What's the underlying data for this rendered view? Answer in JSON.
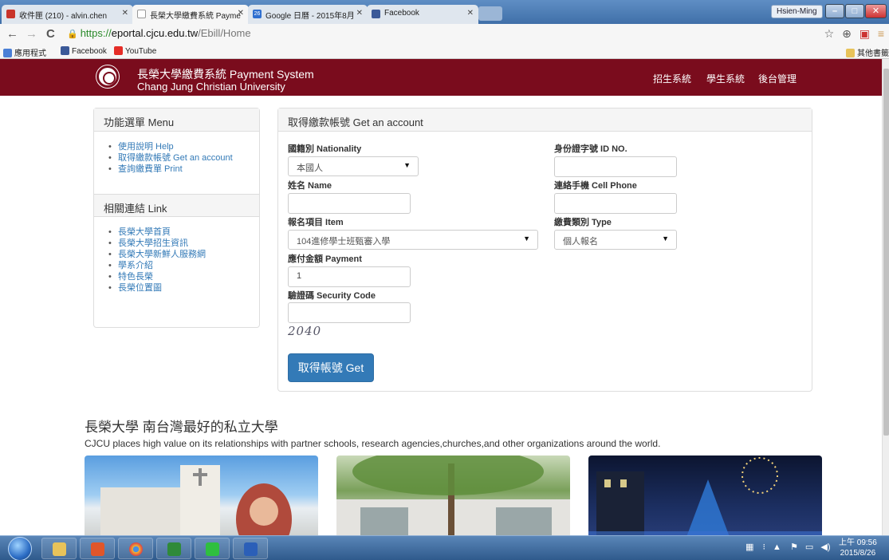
{
  "browser": {
    "tabs": [
      {
        "title": "收件匣 (210) - alvin.chen",
        "icon_color": "#c9342b"
      },
      {
        "title": "長榮大學繳費系統 Payme",
        "icon_color": "#ffffff"
      },
      {
        "title": "Google 日曆 - 2015年8月",
        "icon_color": "#2f6fd0",
        "icon_text": "26"
      },
      {
        "title": "Facebook",
        "icon_color": "#3b5998"
      }
    ],
    "user": "Hsien-Ming",
    "url": {
      "scheme": "https://",
      "host": "eportal.cjcu.edu.tw",
      "path": "/Ebill/Home"
    },
    "bookmarks": [
      {
        "label": "應用程式",
        "icon_color": "#4a7fd6"
      },
      {
        "label": "Facebook",
        "icon_color": "#3b5998"
      },
      {
        "label": "YouTube",
        "icon_color": "#e52d27"
      }
    ],
    "other_bookmarks": "其他書籤"
  },
  "site": {
    "brand_line1": "長榮大學繳費系統 Payment System",
    "brand_line2": "Chang Jung Christian University",
    "nav": [
      "招生系統",
      "學生系統",
      "後台管理"
    ]
  },
  "menu": {
    "title": "功能選單 Menu",
    "items": [
      "使用說明 Help",
      "取得繳款帳號 Get an account",
      "查詢繳費單 Print"
    ]
  },
  "links": {
    "title": "相關連結 Link",
    "items": [
      "長榮大學首頁",
      "長榮大學招生資訊",
      "長榮大學新鮮人服務網",
      "學系介紹",
      "特色長榮",
      "長榮位置圖"
    ]
  },
  "form": {
    "title": "取得繳款帳號 Get an account",
    "nationality_label": "國籍別 Nationality",
    "nationality_value": "本國人",
    "id_label": "身份證字號 ID NO.",
    "name_label": "姓名 Name",
    "phone_label": "連絡手機 Cell Phone",
    "item_label": "報名項目 Item",
    "item_value": "104進修學士班甄審入學",
    "type_label": "繳費類別 Type",
    "type_value": "個人報名",
    "payment_label": "應付金額 Payment",
    "payment_value": "1",
    "security_label": "驗證碼 Security Code",
    "captcha_text": "2040",
    "submit_label": "取得帳號 Get"
  },
  "footer": {
    "slogan": "長榮大學 南台灣最好的私立大學",
    "description": "CJCU places high value on its relationships with partner schools, research agencies,churches,and other organizations around the world."
  },
  "taskbar": {
    "apps": [
      {
        "name": "file-explorer",
        "color": "#e8c35a"
      },
      {
        "name": "office",
        "color": "#e0562a"
      },
      {
        "name": "chrome",
        "color": "#f2b632"
      },
      {
        "name": "excel",
        "color": "#2f8a3a"
      },
      {
        "name": "line",
        "color": "#2fbf3f"
      },
      {
        "name": "word",
        "color": "#2b5fb8"
      }
    ],
    "time": "上午 09:56",
    "date": "2015/8/26"
  }
}
